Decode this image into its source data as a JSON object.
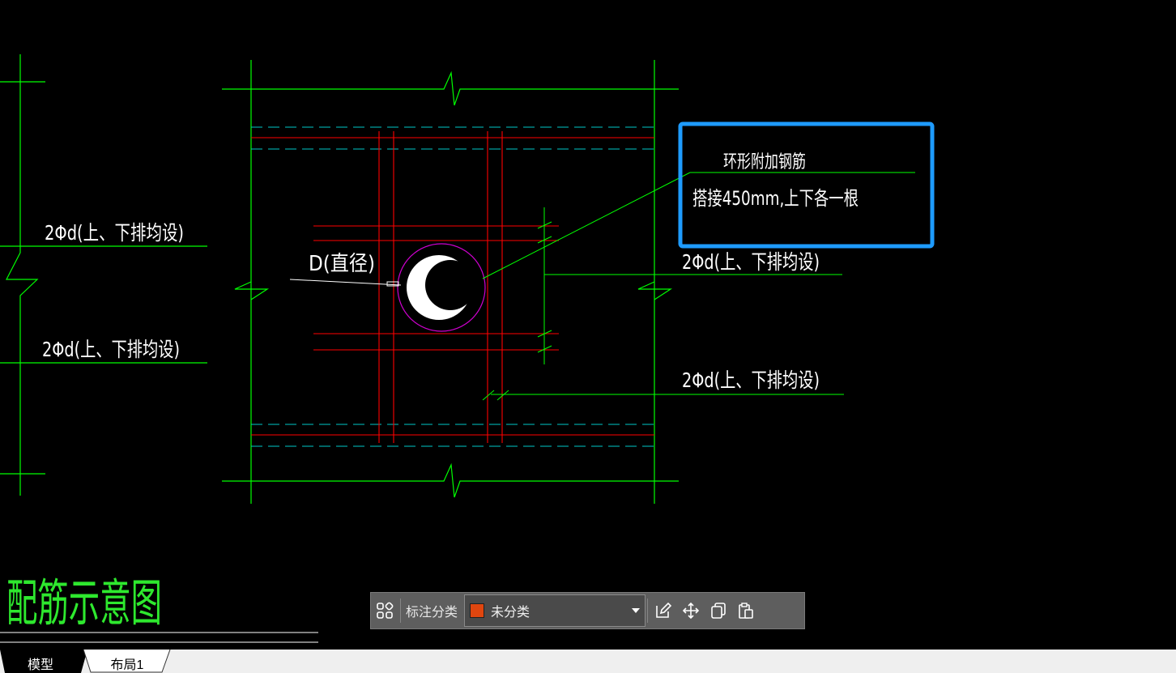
{
  "drawing": {
    "title": "配筋示意图",
    "callout_title": "环形附加钢筋",
    "callout_note": "搭接450mm,上下各一根",
    "diameter_label": "D(直径)",
    "rebar_label_left_top": "2Φd(上、下排均设)",
    "rebar_label_left_bottom": "2Φd(上、下排均设)",
    "rebar_label_right_top": "2Φd(上、下排均设)",
    "rebar_label_right_bottom": "2Φd(上、下排均设)"
  },
  "toolbar": {
    "category_label": "标注分类",
    "category_value": "未分类",
    "category_color": "#e0460f",
    "icons": [
      "grid-icon",
      "edit-icon",
      "move-icon",
      "copy-icon",
      "paste-icon"
    ]
  },
  "tabs": [
    {
      "label": "模型",
      "active": true
    },
    {
      "label": "布局1",
      "active": false
    }
  ],
  "colors": {
    "background": "#000000",
    "green": "#00ff00",
    "red": "#ff0000",
    "cyan": "#00c8c8",
    "magenta": "#d000d0",
    "callout_border": "#1e9bff",
    "title_green": "#2ee82e"
  }
}
